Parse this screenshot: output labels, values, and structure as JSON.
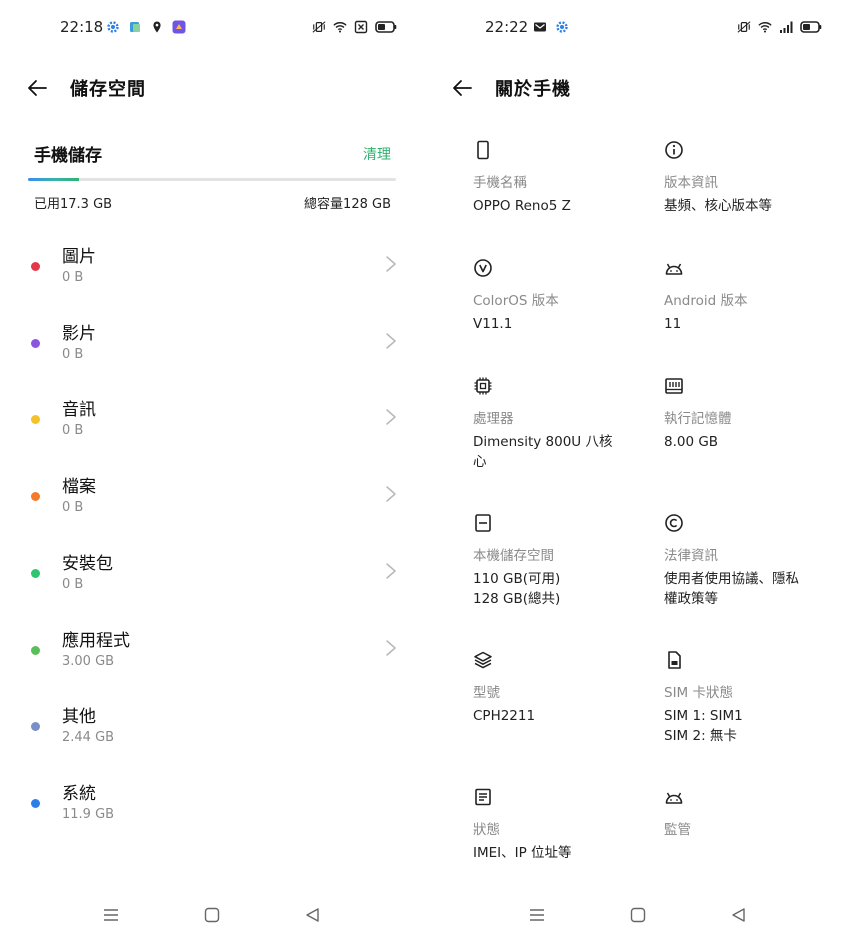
{
  "left": {
    "status": {
      "time": "22:18"
    },
    "header": {
      "title": "儲存空間"
    },
    "storage": {
      "title": "手機儲存",
      "clean_label": "清理",
      "used_label": "已用17.3 GB",
      "total_label": "總容量128 GB",
      "used_fraction": 0.135
    },
    "categories": [
      {
        "name": "圖片",
        "size": "0 B",
        "color": "#e5374a"
      },
      {
        "name": "影片",
        "size": "0 B",
        "color": "#8a55e0"
      },
      {
        "name": "音訊",
        "size": "0 B",
        "color": "#f5c12a"
      },
      {
        "name": "檔案",
        "size": "0 B",
        "color": "#f57a2a"
      },
      {
        "name": "安裝包",
        "size": "0 B",
        "color": "#2fc46e"
      },
      {
        "name": "應用程式",
        "size": "3.00  GB",
        "color": "#5abf5a"
      },
      {
        "name": "其他",
        "size": "2.44 GB",
        "color": "#7b8fc7"
      },
      {
        "name": "系統",
        "size": "11.9 GB",
        "color": "#2b7de9"
      }
    ]
  },
  "right": {
    "status": {
      "time": "22:22"
    },
    "header": {
      "title": "關於手機"
    },
    "items": [
      {
        "icon": "phone-icon",
        "label": "手機名稱",
        "value": "OPPO Reno5 Z"
      },
      {
        "icon": "info-icon",
        "label": "版本資訊",
        "value": "基頻、核心版本等"
      },
      {
        "icon": "coloros-icon",
        "label": "ColorOS 版本",
        "value": "V11.1"
      },
      {
        "icon": "android-icon",
        "label": "Android 版本",
        "value": "11"
      },
      {
        "icon": "processor-icon",
        "label": "處理器",
        "value": "Dimensity 800U 八核\n心"
      },
      {
        "icon": "memory-icon",
        "label": "執行記憶體",
        "value": "8.00 GB"
      },
      {
        "icon": "storage-icon",
        "label": "本機儲存空間",
        "value": "110 GB(可用)\n128 GB(總共)"
      },
      {
        "icon": "copyright-icon",
        "label": "法律資訊",
        "value": "使用者使用協議、隱私\n權政策等"
      },
      {
        "icon": "layers-icon",
        "label": "型號",
        "value": "CPH2211"
      },
      {
        "icon": "sim-icon",
        "label": "SIM 卡狀態",
        "value": "SIM 1: SIM1\nSIM 2: 無卡"
      },
      {
        "icon": "document-icon",
        "label": "狀態",
        "value": "IMEI、IP 位址等"
      },
      {
        "icon": "android-icon",
        "label": "監管",
        "value": ""
      }
    ]
  },
  "colors": {
    "accent": "#2fb16e",
    "secondary_text": "#8a8a8a"
  }
}
